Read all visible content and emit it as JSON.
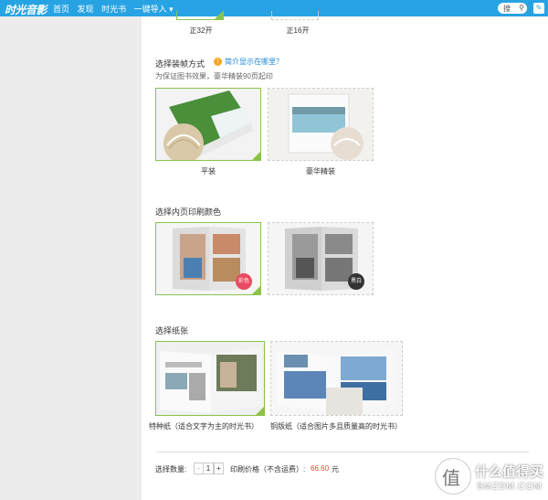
{
  "header": {
    "logo": "时光音影",
    "nav": [
      "首页",
      "发现",
      "时光书",
      "一键导入 ▾"
    ],
    "search_label": "搜",
    "edit_icon": "✎"
  },
  "size": {
    "options": [
      {
        "label": "正32开"
      },
      {
        "label": "正16开"
      }
    ]
  },
  "binding": {
    "title": "选择装帧方式",
    "help_link": "简介显示在哪里？",
    "hint": "为保证图书效果，豪华精装90页起印",
    "options": [
      {
        "label": "平装",
        "selected": true
      },
      {
        "label": "豪华精装",
        "selected": false
      }
    ]
  },
  "color": {
    "title": "选择内页印刷颜色",
    "options": [
      {
        "label": "彩色",
        "selected": true
      },
      {
        "label": "黑白",
        "selected": false
      }
    ]
  },
  "paper": {
    "title": "选择纸张",
    "options": [
      {
        "label": "特种纸（适合文字为主的时光书）",
        "selected": true
      },
      {
        "label": "铜版纸（适合图片多且质量高的时光书）",
        "selected": false
      }
    ]
  },
  "order": {
    "qty_label": "选择数量:",
    "minus": "-",
    "qty": "1",
    "plus": "+",
    "price_label": "印刷价格（不含运费）:",
    "price": "66.60",
    "currency": "元"
  },
  "watermark": {
    "main": "什么值得买",
    "sub": "SMZDM.COM",
    "glyph": "值"
  },
  "colors": {
    "topbar": "#27a3e3",
    "selected_border": "#8bc34a",
    "price": "#f44336",
    "badge_color": "#e84a5f",
    "badge_bw": "#333333"
  }
}
